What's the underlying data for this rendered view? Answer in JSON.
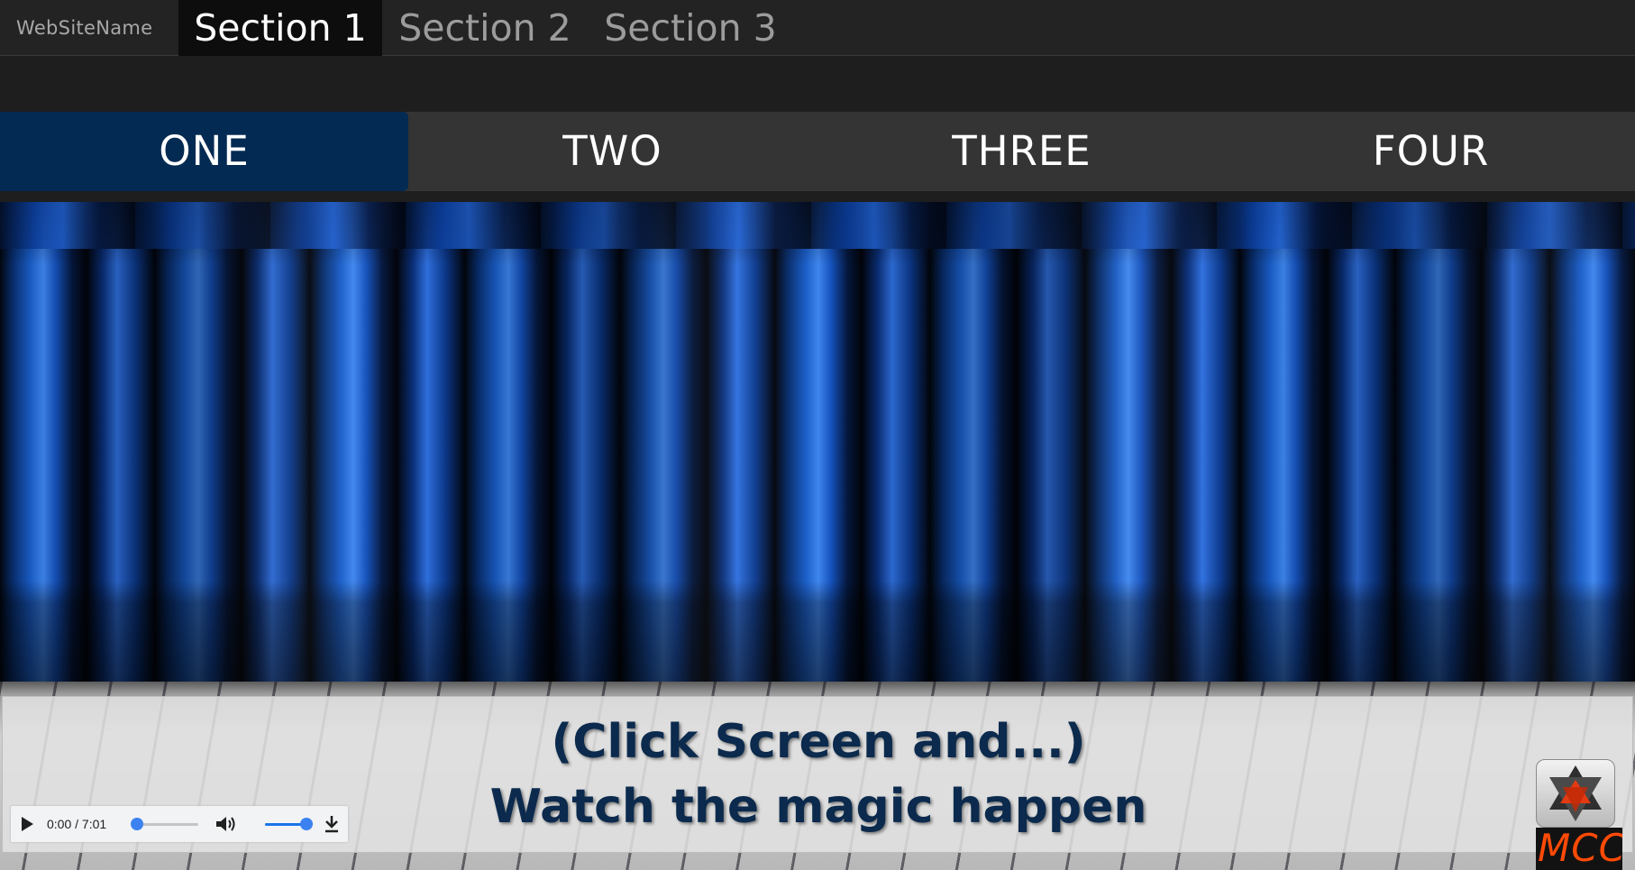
{
  "topnav": {
    "brand": "WebSiteName",
    "tabs": [
      {
        "label": "Section 1",
        "active": true
      },
      {
        "label": "Section 2",
        "active": false
      },
      {
        "label": "Section 3",
        "active": false
      }
    ]
  },
  "pills": [
    {
      "label": "ONE",
      "active": true
    },
    {
      "label": "TWO",
      "active": false
    },
    {
      "label": "THREE",
      "active": false
    },
    {
      "label": "FOUR",
      "active": false
    }
  ],
  "stage": {
    "caption_line1": "(Click Screen and...)",
    "caption_line2": "Watch the magic happen"
  },
  "audio_player": {
    "time": "0:00 / 7:01",
    "progress": 0.0,
    "volume": 1.0,
    "icons": [
      "play-icon",
      "volume-icon",
      "download-icon"
    ]
  },
  "logo": {
    "text": "MCC",
    "icon": "star-tetrahedron-icon"
  },
  "colors": {
    "active_tab": "#032a52",
    "caption_text": "#0b2a4d",
    "logo_orange": "#ff4a06"
  }
}
